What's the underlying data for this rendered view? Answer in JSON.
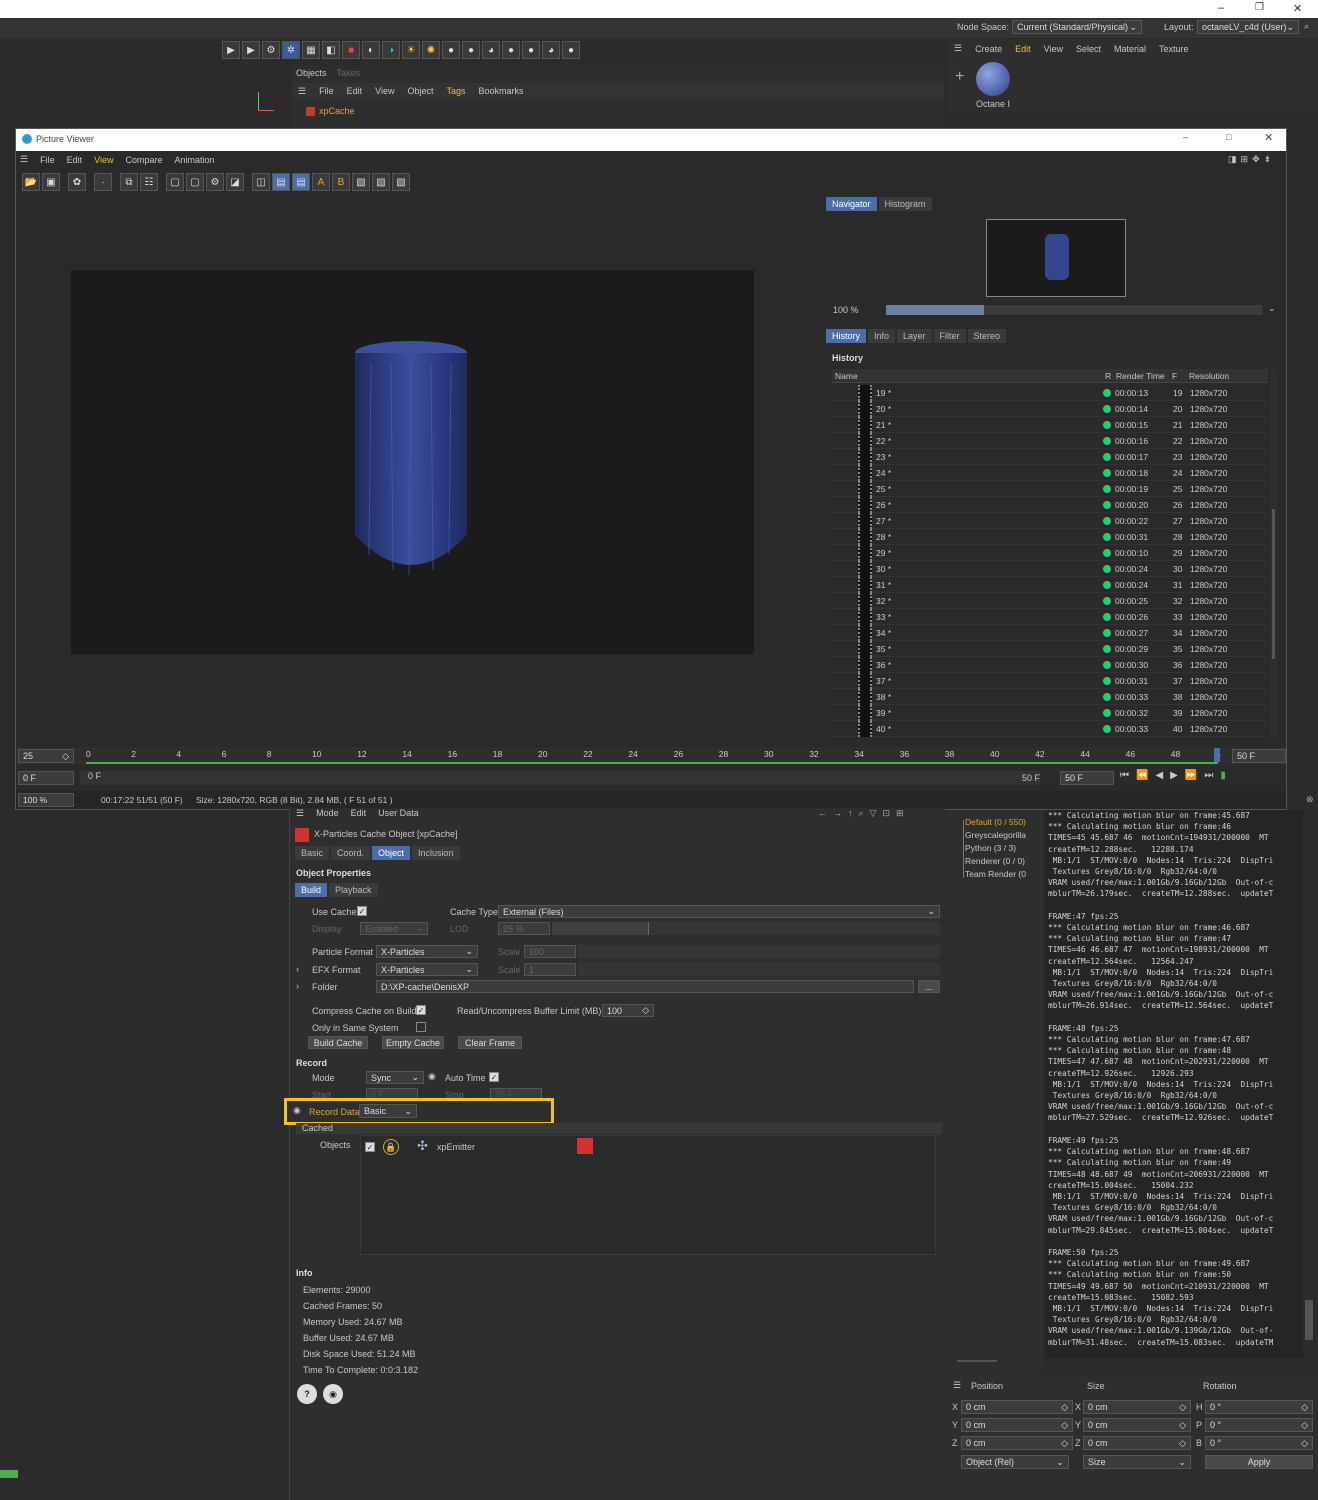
{
  "window_controls": {
    "min": "–",
    "max": "❐",
    "close": "✕"
  },
  "topbar": {
    "node_space_label": "Node Space:",
    "node_space_value": "Current (Standard/Physical)",
    "layout_label": "Layout:",
    "layout_value": "octaneLV_c4d (User)"
  },
  "material_menu": [
    "Create",
    "Edit",
    "View",
    "Select",
    "Material",
    "Texture"
  ],
  "material_name": "Octane I",
  "objects_panel": {
    "tabs": [
      "Objects",
      "Takes"
    ],
    "menu": [
      "File",
      "Edit",
      "View",
      "Object",
      "Tags",
      "Bookmarks"
    ],
    "item": "xpCache"
  },
  "picture_viewer": {
    "title": "Picture Viewer",
    "menu": [
      "File",
      "Edit",
      "View",
      "Compare",
      "Animation"
    ],
    "navigator_tabs": [
      "Navigator",
      "Histogram"
    ],
    "zoom": "100 %",
    "history_tabs": [
      "History",
      "Info",
      "Layer",
      "Filter",
      "Stereo"
    ],
    "history_title": "History",
    "columns": [
      "Name",
      "R",
      "Render Time",
      "F",
      "Resolution"
    ],
    "rows": [
      {
        "name": "19 *",
        "time": "00:00:13",
        "f": "19",
        "res": "1280x720"
      },
      {
        "name": "20 *",
        "time": "00:00:14",
        "f": "20",
        "res": "1280x720"
      },
      {
        "name": "21 *",
        "time": "00:00:15",
        "f": "21",
        "res": "1280x720"
      },
      {
        "name": "22 *",
        "time": "00:00:16",
        "f": "22",
        "res": "1280x720"
      },
      {
        "name": "23 *",
        "time": "00:00:17",
        "f": "23",
        "res": "1280x720"
      },
      {
        "name": "24 *",
        "time": "00:00:18",
        "f": "24",
        "res": "1280x720"
      },
      {
        "name": "25 *",
        "time": "00:00:19",
        "f": "25",
        "res": "1280x720"
      },
      {
        "name": "26 *",
        "time": "00:00:20",
        "f": "26",
        "res": "1280x720"
      },
      {
        "name": "27 *",
        "time": "00:00:22",
        "f": "27",
        "res": "1280x720"
      },
      {
        "name": "28 *",
        "time": "00:00:31",
        "f": "28",
        "res": "1280x720"
      },
      {
        "name": "29 *",
        "time": "00:00:10",
        "f": "29",
        "res": "1280x720"
      },
      {
        "name": "30 *",
        "time": "00:00:24",
        "f": "30",
        "res": "1280x720"
      },
      {
        "name": "31 *",
        "time": "00:00:24",
        "f": "31",
        "res": "1280x720"
      },
      {
        "name": "32 *",
        "time": "00:00:25",
        "f": "32",
        "res": "1280x720"
      },
      {
        "name": "33 *",
        "time": "00:00:26",
        "f": "33",
        "res": "1280x720"
      },
      {
        "name": "34 *",
        "time": "00:00:27",
        "f": "34",
        "res": "1280x720"
      },
      {
        "name": "35 *",
        "time": "00:00:29",
        "f": "35",
        "res": "1280x720"
      },
      {
        "name": "36 *",
        "time": "00:00:30",
        "f": "36",
        "res": "1280x720"
      },
      {
        "name": "37 *",
        "time": "00:00:31",
        "f": "37",
        "res": "1280x720"
      },
      {
        "name": "38 *",
        "time": "00:00:33",
        "f": "38",
        "res": "1280x720"
      },
      {
        "name": "39 *",
        "time": "00:00:32",
        "f": "39",
        "res": "1280x720"
      },
      {
        "name": "40 *",
        "time": "00:00:33",
        "f": "40",
        "res": "1280x720"
      }
    ],
    "timeline": {
      "fps": "25",
      "ticks": [
        "0",
        "2",
        "4",
        "6",
        "8",
        "10",
        "12",
        "14",
        "16",
        "18",
        "20",
        "22",
        "24",
        "26",
        "28",
        "30",
        "32",
        "34",
        "36",
        "38",
        "40",
        "42",
        "44",
        "46",
        "48",
        "5"
      ],
      "end": "50 F",
      "start": "0 F",
      "start2": "0 F",
      "end2": "50 F",
      "end3": "50 F"
    },
    "status": {
      "zoom": "100 %",
      "time": "00:17:22 51/51 (50 F)",
      "info": "Size: 1280x720, RGB (8 Bit), 2.84 MB,  ( F 51 of 51 )"
    }
  },
  "attributes": {
    "menu": [
      "Mode",
      "Edit",
      "User Data"
    ],
    "object_title": "X-Particles Cache Object [xpCache]",
    "tabs": [
      "Basic",
      "Coord.",
      "Object",
      "Inclusion"
    ],
    "section": "Object Properties",
    "subtabs": [
      "Build",
      "Playback"
    ],
    "use_cache": "Use Cache",
    "display_label": "Display",
    "display_value": "Enabled",
    "cache_type_label": "Cache Type",
    "cache_type_value": "External (Files)",
    "lod_label": "LOD",
    "lod_value": "25 %",
    "particle_format_label": "Particle Format",
    "particle_format_value": "X-Particles",
    "efx_format_label": "EFX Format",
    "efx_format_value": "X-Particles",
    "scale_label": "Scale",
    "scale1": "100",
    "scale2": "1",
    "folder_label": "Folder",
    "folder_value": "D:\\XP-cache\\DenisXP",
    "folder_btn": "...",
    "compress_label": "Compress Cache on Build",
    "buffer_label": "Read/Uncompress Buffer Limit (MB)",
    "buffer_value": "100",
    "same_system_label": "Only in Same System",
    "buttons": [
      "Build Cache",
      "Empty Cache",
      "Clear Frame"
    ],
    "record_title": "Record",
    "mode_label": "Mode",
    "mode_value": "Sync",
    "auto_time_label": "Auto Time",
    "start_label": "Start",
    "start_value": "0 F",
    "stop_label": "Stop",
    "stop_value": "75 F",
    "record_data_label": "Record Data",
    "record_data_value": "Basic",
    "cached_label": "Cached",
    "objects_label": "Objects",
    "emitter_name": "xpEmitter",
    "info_title": "Info",
    "info_lines": [
      "Elements: 29000",
      "Cached Frames: 50",
      "Memory Used: 24.67 MB",
      "Buffer Used: 24.67 MB",
      "Disk Space Used: 51.24 MB",
      "Time To Complete: 0:0:3.182"
    ]
  },
  "takes_tree": [
    "Default (0 / 550)",
    "Greyscalegorilla",
    "Python (3 / 3)",
    "Renderer (0 / 0)",
    "Team Render (0"
  ],
  "console_lines": [
    "*** Calculating motion blur on frame:45.687",
    "*** Calculating motion blur on frame:46",
    "TIMES=45 45.687 46  motionCnt=194931/200000  MT",
    "createTM=12.288sec.   12288.174",
    " MB:1/1  ST/MOV:0/0  Nodes:14  Tris:224  DispTri",
    " Textures Grey8/16:0/0  Rgb32/64:0/0",
    "VRAM used/free/max:1.001Gb/9.16Gb/12Gb  Out-of-c",
    "mblurTM=26.179sec.  createTM=12.288sec.  updateT",
    "",
    "FRAME:47 fps:25",
    "*** Calculating motion blur on frame:46.687",
    "*** Calculating motion blur on frame:47",
    "TIMES=46 46.687 47  motionCnt=198931/200000  MT",
    "createTM=12.564sec.   12564.247",
    " MB:1/1  ST/MOV:0/0  Nodes:14  Tris:224  DispTri",
    " Textures Grey8/16:0/0  Rgb32/64:0/0",
    "VRAM used/free/max:1.001Gb/9.16Gb/12Gb  Out-of-c",
    "mblurTM=26.914sec.  createTM=12.564sec.  updateT",
    "",
    "FRAME:48 fps:25",
    "*** Calculating motion blur on frame:47.687",
    "*** Calculating motion blur on frame:48",
    "TIMES=47 47.687 48  motionCnt=202931/220000  MT",
    "createTM=12.926sec.   12926.293",
    " MB:1/1  ST/MOV:0/0  Nodes:14  Tris:224  DispTri",
    " Textures Grey8/16:0/0  Rgb32/64:0/0",
    "VRAM used/free/max:1.001Gb/9.16Gb/12Gb  Out-of-c",
    "mblurTM=27.529sec.  createTM=12.926sec.  updateT",
    "",
    "FRAME:49 fps:25",
    "*** Calculating motion blur on frame:48.687",
    "*** Calculating motion blur on frame:49",
    "TIMES=48 48.687 49  motionCnt=206931/220000  MT",
    "createTM=15.004sec.   15004.232",
    " MB:1/1  ST/MOV:0/0  Nodes:14  Tris:224  DispTri",
    " Textures Grey8/16:0/0  Rgb32/64:0/0",
    "VRAM used/free/max:1.001Gb/9.16Gb/12Gb  Out-of-c",
    "mblurTM=29.845sec.  createTM=15.004sec.  updateT",
    "",
    "FRAME:50 fps:25",
    "*** Calculating motion blur on frame:49.687",
    "*** Calculating motion blur on frame:50",
    "TIMES=49 49.687 50  motionCnt=210931/220000  MT",
    "createTM=15.083sec.   15082.593",
    " MB:1/1  ST/MOV:0/0  Nodes:14  Tris:224  DispTri",
    " Textures Grey8/16:0/0  Rgb32/64:0/0",
    "VRAM used/free/max:1.001Gb/9.139Gb/12Gb  Out-of-",
    "mblurTM=31.48sec.  createTM=15.083sec.  updateTM"
  ],
  "coords": {
    "headers": [
      "Position",
      "Size",
      "Rotation"
    ],
    "rows": [
      {
        "axis": "X",
        "pos": "0 cm",
        "saxis": "X",
        "size": "0 cm",
        "raxis": "H",
        "rot": "0 °"
      },
      {
        "axis": "Y",
        "pos": "0 cm",
        "saxis": "Y",
        "size": "0 cm",
        "raxis": "P",
        "rot": "0 °"
      },
      {
        "axis": "Z",
        "pos": "0 cm",
        "saxis": "Z",
        "size": "0 cm",
        "raxis": "B",
        "rot": "0 °"
      }
    ],
    "mode1": "Object (Rel)",
    "mode2": "Size",
    "apply": "Apply"
  },
  "colors": {
    "accent": "#4a6ea9",
    "highlight": "#f0c419",
    "green": "#2ecc71",
    "red": "#d0342c"
  }
}
